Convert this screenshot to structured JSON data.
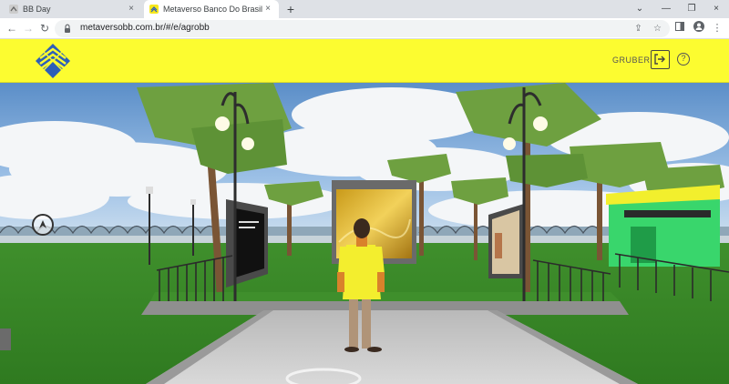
{
  "browser": {
    "tabs": [
      {
        "title": "BB Day",
        "active": false
      },
      {
        "title": "Metaverso Banco Do Brasil BBDA",
        "active": true
      }
    ],
    "url": "metaversobb.com.br/#/e/agrobb"
  },
  "header": {
    "username": "GRUBER",
    "help_label": "?"
  },
  "colors": {
    "header_yellow": "#fcfc30",
    "bb_blue": "#2d5fb8",
    "shirt_yellow": "#f3ee2e",
    "grass": "#3a8a2a"
  },
  "icons": {
    "back": "←",
    "forward": "→",
    "reload": "↻",
    "share": "⇪",
    "star": "☆",
    "menu": "⋮",
    "close": "×",
    "newtab": "+"
  }
}
